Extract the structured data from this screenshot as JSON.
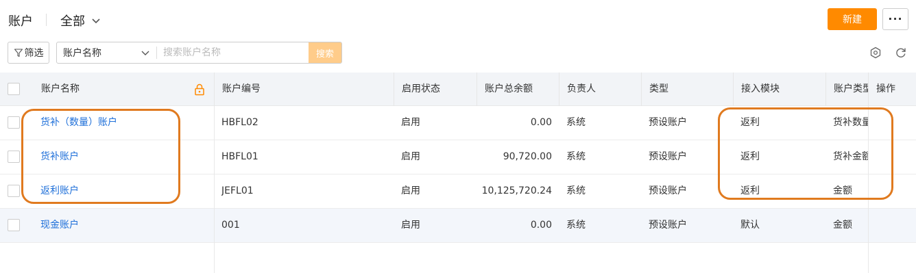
{
  "header": {
    "title": "账户",
    "scope": "全部",
    "new_button": "新建",
    "more_button": "···"
  },
  "toolbar": {
    "filter_label": "筛选",
    "search_field": "账户名称",
    "search_placeholder": "搜索账户名称",
    "search_button": "搜索"
  },
  "table": {
    "columns": [
      "账户名称",
      "账户编号",
      "启用状态",
      "账户总余额",
      "负责人",
      "类型",
      "接入模块",
      "账户类型",
      "操作"
    ],
    "rows": [
      {
        "name": "货补（数量）账户",
        "code": "HBFL02",
        "status": "启用",
        "balance": "0.00",
        "owner": "系统",
        "type": "预设账户",
        "module": "返利",
        "account_type": "货补数量"
      },
      {
        "name": "货补账户",
        "code": "HBFL01",
        "status": "启用",
        "balance": "90,720.00",
        "owner": "系统",
        "type": "预设账户",
        "module": "返利",
        "account_type": "货补金额"
      },
      {
        "name": "返利账户",
        "code": "JEFL01",
        "status": "启用",
        "balance": "10,125,720.24",
        "owner": "系统",
        "type": "预设账户",
        "module": "返利",
        "account_type": "金额"
      },
      {
        "name": "现金账户",
        "code": "001",
        "status": "启用",
        "balance": "0.00",
        "owner": "系统",
        "type": "预设账户",
        "module": "默认",
        "account_type": "金额"
      }
    ]
  },
  "colors": {
    "accent": "#ff8a00",
    "link": "#1e6fd9",
    "annotation": "#e07a1f"
  }
}
